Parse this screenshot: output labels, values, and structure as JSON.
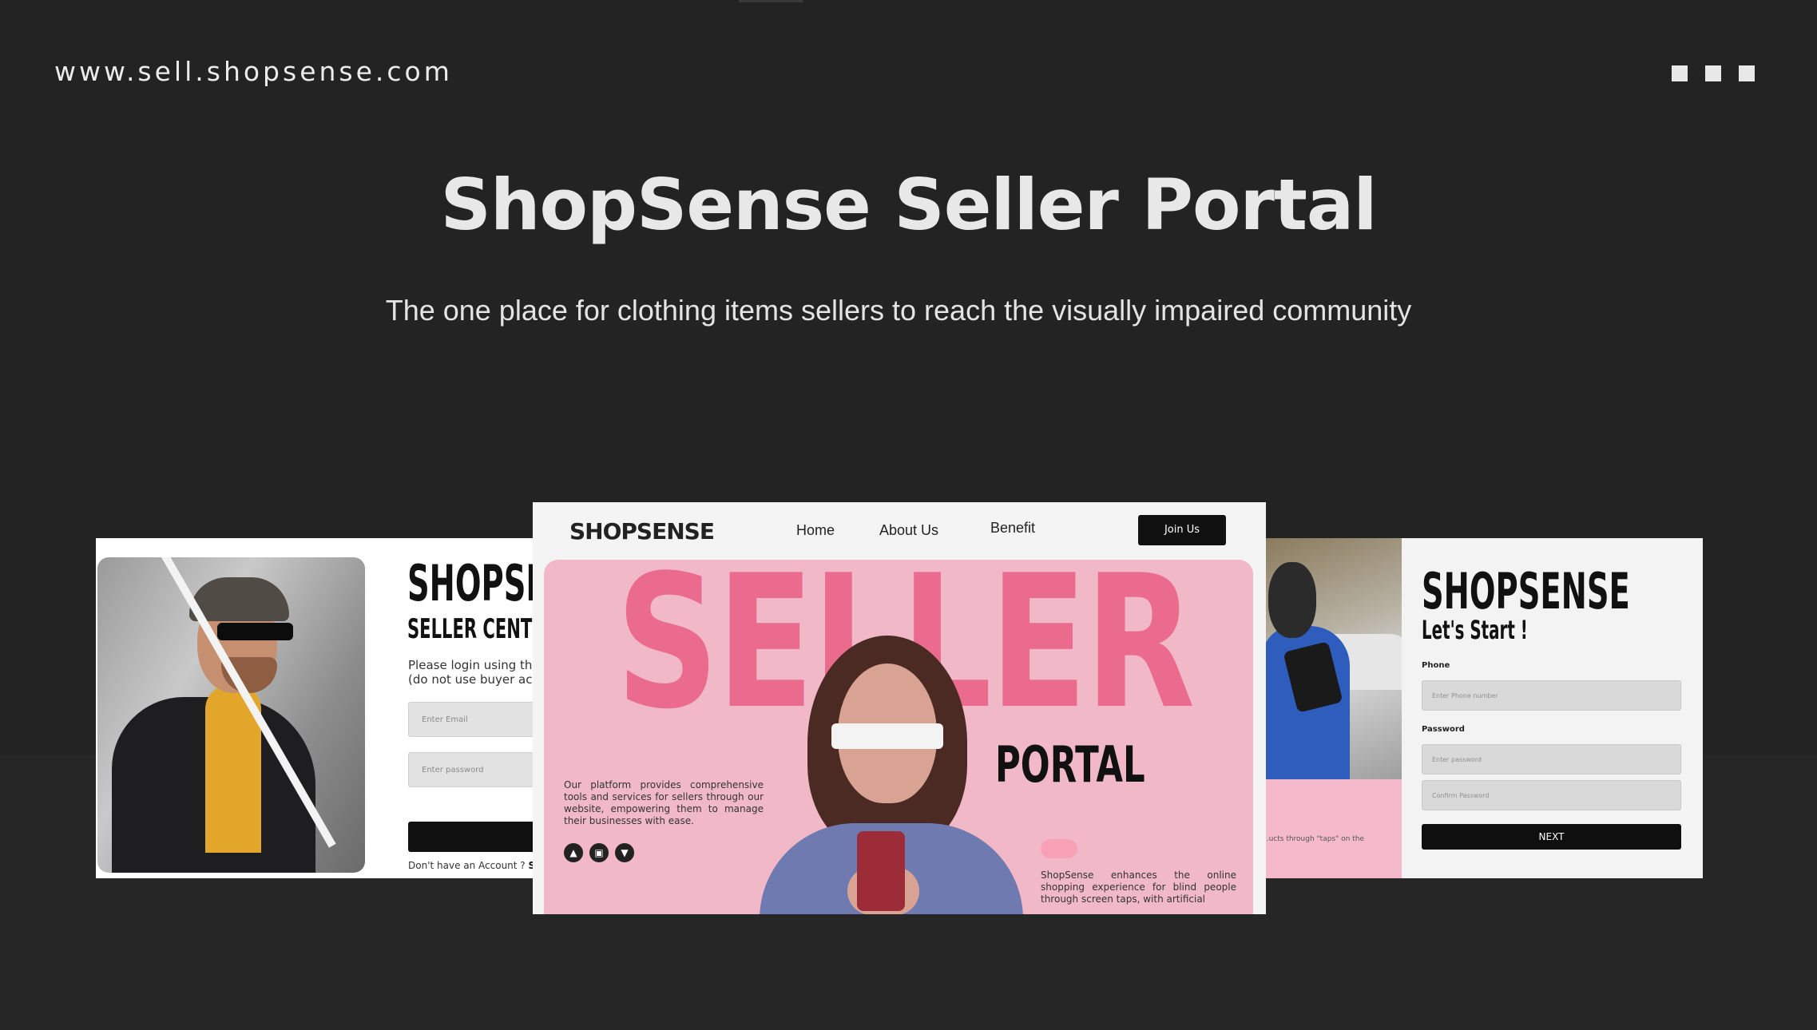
{
  "header": {
    "url": "www.sell.shopsense.com",
    "menu_icon": "three-squares-icon"
  },
  "hero": {
    "title": "ShopSense Seller Portal",
    "subtitle": "The one place for clothing items sellers to reach the visually impaired community"
  },
  "left_card": {
    "brand": "SHOPSE",
    "subtitle": "SELLER CENTER",
    "text": "Please login using the\n(do not use buyer acco",
    "email_placeholder": "Enter Email",
    "password_placeholder": "Enter password",
    "footer_text": "Don't have an Account ? ",
    "footer_link": "Sign"
  },
  "center_card": {
    "logo": "SHOPSENSE",
    "nav": [
      "Home",
      "About Us",
      "Benefit"
    ],
    "join_label": "Join Us",
    "hero_word": "SELLER",
    "hero_sub": "PORTAL",
    "left_text": "Our platform provides comprehensive tools and services for sellers through our website, empowering them to manage their businesses with ease.",
    "right_text": "ShopSense enhances the online shopping experience for blind people through screen taps, with artificial",
    "icons": [
      "alert-icon",
      "bag-icon",
      "shirt-icon"
    ]
  },
  "right_card": {
    "left_snippet": "...ucts through \"taps\" on the",
    "brand": "SHOPSENSE",
    "subtitle": "Let's Start !",
    "phone_label": "Phone",
    "phone_placeholder": "Enter Phone number",
    "password_label": "Password",
    "password_placeholder": "Enter password",
    "confirm_placeholder": "Confirm Password",
    "next_label": "NEXT"
  }
}
